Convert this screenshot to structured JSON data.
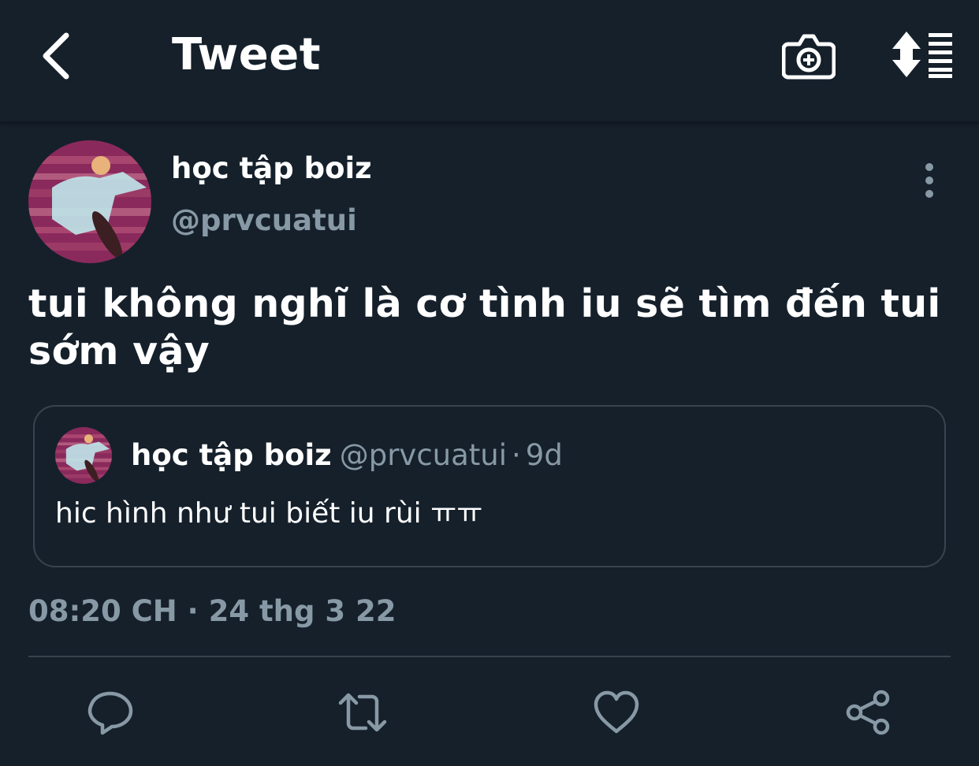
{
  "header": {
    "title": "Tweet",
    "back_icon": "chevron-left-icon",
    "camera_icon": "camera-add-icon",
    "sort_icon": "sort-lines-icon"
  },
  "tweet": {
    "display_name": "học tập boiz",
    "handle": "@prvcuatui",
    "text": "tui không nghĩ là cơ tình iu sẽ tìm đến tui sớm vậy",
    "timestamp": "08:20 CH · 24 thg 3 22"
  },
  "quote": {
    "display_name": "học tập boiz",
    "handle": "@prvcuatui",
    "separator": "·",
    "time": "9d",
    "text": "hic hình như tui biết iu rùi ㅠㅠ"
  },
  "actions": [
    {
      "icon": "reply-icon"
    },
    {
      "icon": "retweet-icon"
    },
    {
      "icon": "like-icon"
    },
    {
      "icon": "share-icon"
    }
  ],
  "colors": {
    "background": "#15202b",
    "primary_text": "#ffffff",
    "secondary_text": "#8899a6",
    "border": "#38444d",
    "avatar_bg": "#8a2a5c"
  }
}
